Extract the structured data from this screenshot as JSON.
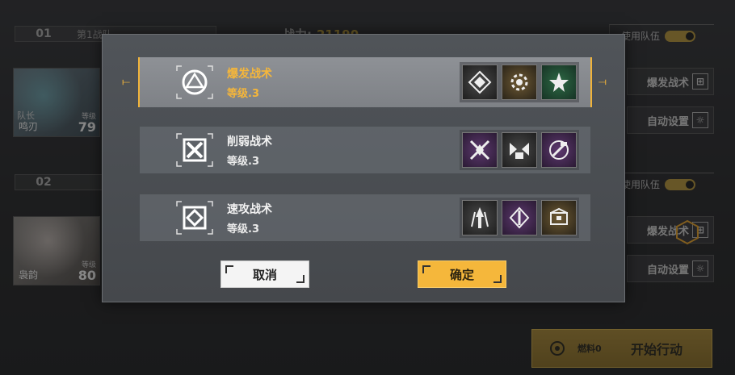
{
  "background": {
    "team1": {
      "number": "01",
      "name": "第1战队"
    },
    "team2": {
      "number": "02"
    },
    "power": {
      "label": "战力:",
      "value": "21190"
    },
    "members": [
      {
        "caption": "队长",
        "name": "鸣刃",
        "level_label": "等级",
        "level": "79"
      },
      {
        "name": "袅韵",
        "level_label": "等级",
        "level": "80"
      }
    ],
    "use_team_label": "使用队伍",
    "burst_tactic_label": "爆发战术",
    "auto_setup_label": "自动设置",
    "start": {
      "fuel": "燃料0",
      "label": "开始行动"
    }
  },
  "modal": {
    "tactics": [
      {
        "title": "爆发战术",
        "level": "等级.3",
        "selected": true,
        "icon": "burst-tactic-icon",
        "slots": [
          "gray",
          "gold",
          "green"
        ]
      },
      {
        "title": "削弱战术",
        "level": "等级.3",
        "selected": false,
        "icon": "weaken-tactic-icon",
        "slots": [
          "purple",
          "gray",
          "purple"
        ]
      },
      {
        "title": "速攻战术",
        "level": "等级.3",
        "selected": false,
        "icon": "rush-tactic-icon",
        "slots": [
          "gray",
          "purple",
          "gold"
        ]
      }
    ],
    "cancel_label": "取消",
    "confirm_label": "确定"
  },
  "colors": {
    "accent": "#f5b73b",
    "selected_text": "#f5b63a"
  }
}
